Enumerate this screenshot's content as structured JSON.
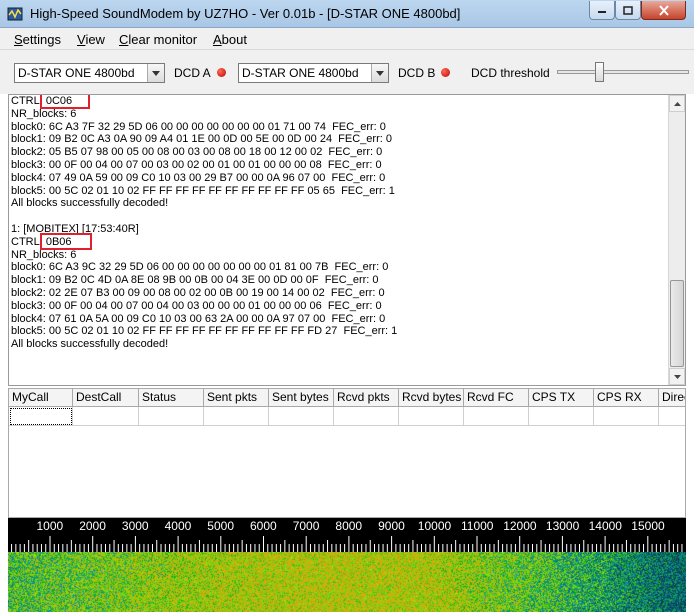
{
  "window": {
    "title": "High-Speed SoundModem by UZ7HO - Ver 0.01b - [D-STAR ONE 4800bd]",
    "controls": [
      "minimize-icon",
      "maximize-icon",
      "close-icon"
    ]
  },
  "menu": {
    "items": [
      {
        "label": "Settings",
        "underline": "S",
        "rest": "ettings"
      },
      {
        "label": "View",
        "underline": "V",
        "rest": "iew"
      },
      {
        "label": "Clear monitor",
        "underline": "C",
        "rest": "lear monitor"
      },
      {
        "label": "About",
        "underline": "A",
        "rest": "bout"
      }
    ]
  },
  "toolbar": {
    "modem_a": "D-STAR ONE 4800bd",
    "dcd_a_label": "DCD A",
    "modem_b": "D-STAR ONE 4800bd",
    "dcd_b_label": "DCD B",
    "dcd_threshold_label": "DCD threshold",
    "dcd_threshold_level": 0.31,
    "led_color": "#c00000"
  },
  "monitor": {
    "lines": [
      "CTRL: 0C06",
      "NR_blocks: 6",
      "block0: 6C A3 7F 32 29 5D 06 00 00 00 00 00 00 00 01 71 00 74  FEC_err: 0",
      "block1: 09 B2 0C A3 0A 90 09 A4 01 1E 00 0D 00 5E 00 0D 00 24  FEC_err: 0",
      "block2: 05 B5 07 98 00 05 00 08 00 03 00 08 00 18 00 12 00 02  FEC_err: 0",
      "block3: 00 0F 00 04 00 07 00 03 00 02 00 01 00 01 00 00 00 08  FEC_err: 0",
      "block4: 07 49 0A 59 00 09 C0 10 03 00 29 B7 00 00 0A 96 07 00  FEC_err: 0",
      "block5: 00 5C 02 01 10 02 FF FF FF FF FF FF FF FF FF FF 05 65  FEC_err: 1",
      "All blocks successfully decoded!",
      "",
      "1: [MOBITEX] [17:53:40R]",
      "CTRL: 0B06",
      "NR_blocks: 6",
      "block0: 6C A3 9C 32 29 5D 06 00 00 00 00 00 00 00 01 81 00 7B  FEC_err: 0",
      "block1: 09 B2 0C 4D 0A 8E 08 9B 00 0B 00 04 3E 00 0D 00 0F  FEC_err: 0",
      "block2: 02 2E 07 B3 00 09 00 08 00 02 00 0B 00 19 00 14 00 02  FEC_err: 0",
      "block3: 00 0F 00 04 00 07 00 04 00 03 00 00 00 01 00 00 00 06  FEC_err: 0",
      "block4: 07 61 0A 5A 00 09 C0 10 03 00 63 2A 00 00 0A 97 07 00  FEC_err: 0",
      "block5: 00 5C 02 01 10 02 FF FF FF FF FF FF FF FF FF FF FD 27  FEC_err: 1",
      "All blocks successfully decoded!"
    ],
    "highlight_color": "#e0202a"
  },
  "table": {
    "columns": [
      "MyCall",
      "DestCall",
      "Status",
      "Sent pkts",
      "Sent bytes",
      "Rcvd pkts",
      "Rcvd bytes",
      "Rcvd FC",
      "CPS TX",
      "CPS RX",
      "Direct"
    ],
    "rows": []
  },
  "waterfall": {
    "scale_labels": [
      "1000",
      "2000",
      "3000",
      "4000",
      "5000",
      "6000",
      "7000",
      "8000",
      "9000",
      "10000",
      "11000",
      "12000",
      "13000",
      "14000",
      "15000"
    ]
  }
}
